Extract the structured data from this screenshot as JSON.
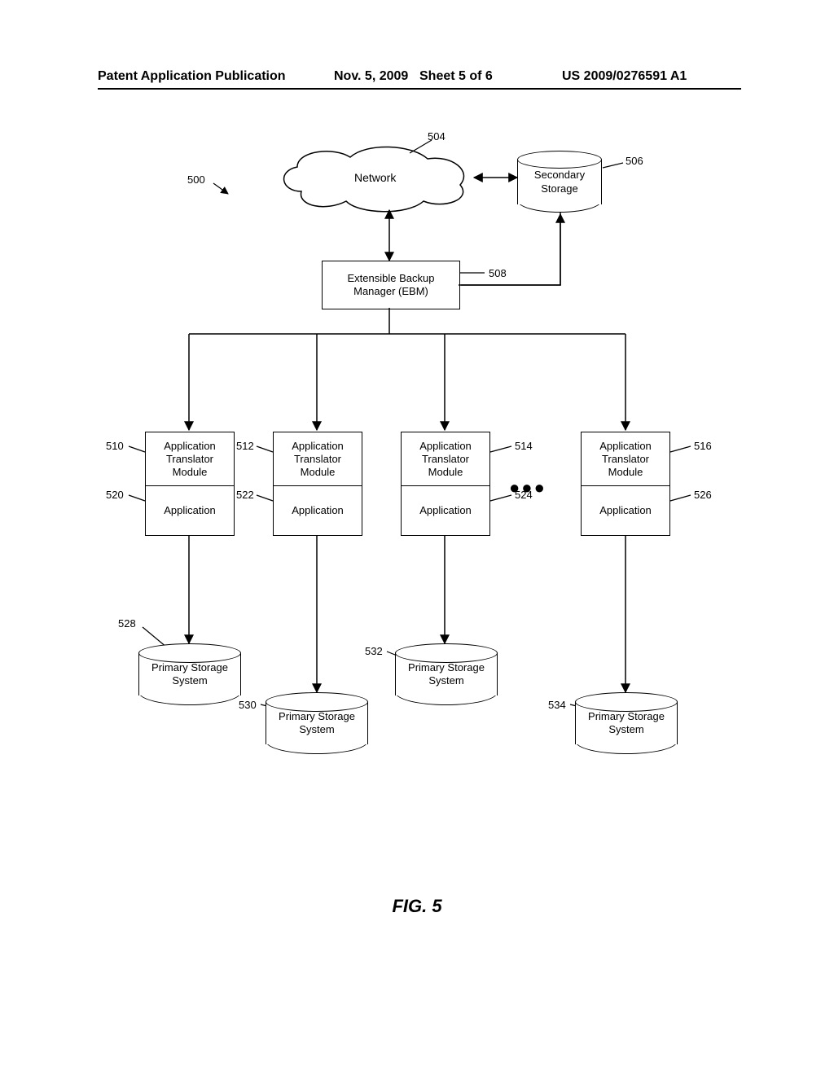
{
  "header": {
    "left": "Patent Application Publication",
    "date": "Nov. 5, 2009",
    "sheet": "Sheet 5 of 6",
    "pubno": "US 2009/0276591 A1"
  },
  "figure_label": "FIG. 5",
  "refs": {
    "r500": "500",
    "r504": "504",
    "r506": "506",
    "r508": "508",
    "r510": "510",
    "r512": "512",
    "r514": "514",
    "r516": "516",
    "r520": "520",
    "r522": "522",
    "r524": "524",
    "r526": "526",
    "r528": "528",
    "r530": "530",
    "r532": "532",
    "r534": "534"
  },
  "nodes": {
    "network": "Network",
    "secondary_storage": "Secondary\nStorage",
    "ebm": "Extensible Backup\nManager (EBM)",
    "atm": "Application\nTranslator\nModule",
    "app": "Application",
    "pss": "Primary Storage\nSystem"
  },
  "ellipsis": "●●●"
}
